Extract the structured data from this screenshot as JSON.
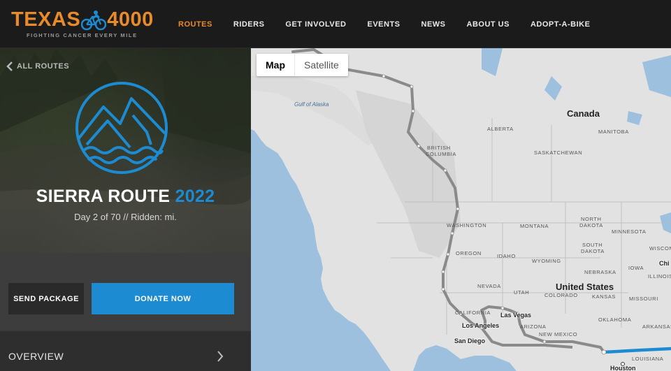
{
  "brand": {
    "name_part1": "TEXAS",
    "name_part2": "4000",
    "tagline": "FIGHTING CANCER EVERY MILE"
  },
  "nav": {
    "items": [
      {
        "label": "ROUTES",
        "active": true
      },
      {
        "label": "RIDERS"
      },
      {
        "label": "GET INVOLVED"
      },
      {
        "label": "EVENTS"
      },
      {
        "label": "NEWS"
      },
      {
        "label": "ABOUT US"
      },
      {
        "label": "ADOPT-A-BIKE"
      }
    ]
  },
  "route": {
    "back_label": "ALL ROUTES",
    "title": "SIERRA ROUTE",
    "year": "2022",
    "subtitle": "Day 2 of 70 // Ridden: mi."
  },
  "actions": {
    "send_package": "SEND PACKAGE",
    "donate": "DONATE NOW"
  },
  "overview": {
    "label": "OVERVIEW"
  },
  "map": {
    "type_map": "Map",
    "type_satellite": "Satellite",
    "labels": {
      "canada": "Canada",
      "united_states": "United States",
      "gulf_of_alaska": "Gulf of Alaska",
      "alberta": "ALBERTA",
      "manitoba": "MANITOBA",
      "saskatchewan": "SASKATCHEWAN",
      "british": "BRITISH",
      "columbia": "COLUMBIA",
      "washington": "WASHINGTON",
      "montana": "MONTANA",
      "north": "NORTH",
      "dakota1": "DAKOTA",
      "minnesota": "MINNESOTA",
      "oregon": "OREGON",
      "idaho": "IDAHO",
      "south": "SOUTH",
      "dakota2": "DAKOTA",
      "wisconsin": "WISCONSIN",
      "wyoming": "WYOMING",
      "nebraska": "NEBRASKA",
      "iowa": "IOWA",
      "nevada": "NEVADA",
      "utah": "UTAH",
      "colorado": "COLORADO",
      "kansas": "KANSAS",
      "illinois": "ILLINOIS",
      "california": "CALIFORNIA",
      "missouri": "MISSOURI",
      "arizona": "ARIZONA",
      "oklahoma": "OKLAHOMA",
      "new_mexico": "NEW MEXICO",
      "arkansas": "ARKANSAS",
      "louisiana": "LOUISIANA",
      "chi": "Chi",
      "las_vegas": "Las Vegas",
      "los_angeles": "Los Angeles",
      "san_diego": "San Diego",
      "houston": "Houston"
    }
  },
  "colors": {
    "brand_orange": "#e88b2a",
    "accent_blue": "#1d8bd1",
    "route_gray": "#8a8a8a",
    "route_blue": "#1d8bd1",
    "ocean": "#9cc0dd"
  }
}
